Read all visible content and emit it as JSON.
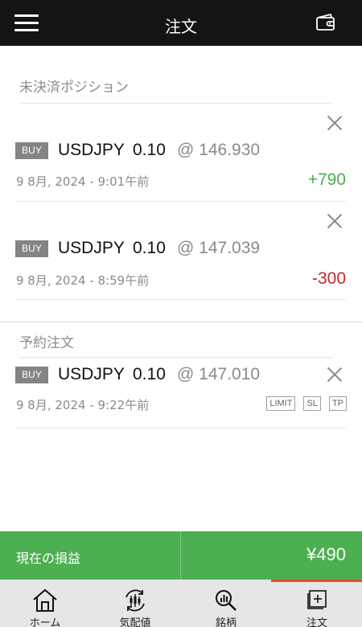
{
  "header": {
    "title": "注文",
    "menu_icon": "hamburger-menu-icon",
    "wallet_icon": "wallet-icon"
  },
  "open_positions": {
    "title": "未決済ポジション",
    "items": [
      {
        "side": "BUY",
        "symbol": "USDJPY",
        "lot": "0.10",
        "price": "@ 146.930",
        "time": "9 8月, 2024 - 9:01午前",
        "pl": "+790",
        "pl_color": "#4caf50"
      },
      {
        "side": "BUY",
        "symbol": "USDJPY",
        "lot": "0.10",
        "price": "@ 147.039",
        "time": "9 8月, 2024 - 8:59午前",
        "pl": "-300",
        "pl_color": "#c62828"
      }
    ]
  },
  "pending_orders": {
    "title": "予約注文",
    "items": [
      {
        "side": "BUY",
        "symbol": "USDJPY",
        "lot": "0.10",
        "price": "@ 147.010",
        "time": "9 8月, 2024 - 9:22午前",
        "tags": [
          "LIMIT",
          "SL",
          "TP"
        ]
      }
    ]
  },
  "pnl": {
    "label": "現在の損益",
    "value": "¥490",
    "color": "#4caf50"
  },
  "nav": {
    "items": [
      {
        "label": "ホーム",
        "icon": "home-icon"
      },
      {
        "label": "気配値",
        "icon": "candlestick-icon"
      },
      {
        "label": "銘柄",
        "icon": "search-chart-icon"
      },
      {
        "label": "注文",
        "icon": "order-icon"
      }
    ],
    "active_index": 3,
    "active_color": "#e64a2e"
  }
}
